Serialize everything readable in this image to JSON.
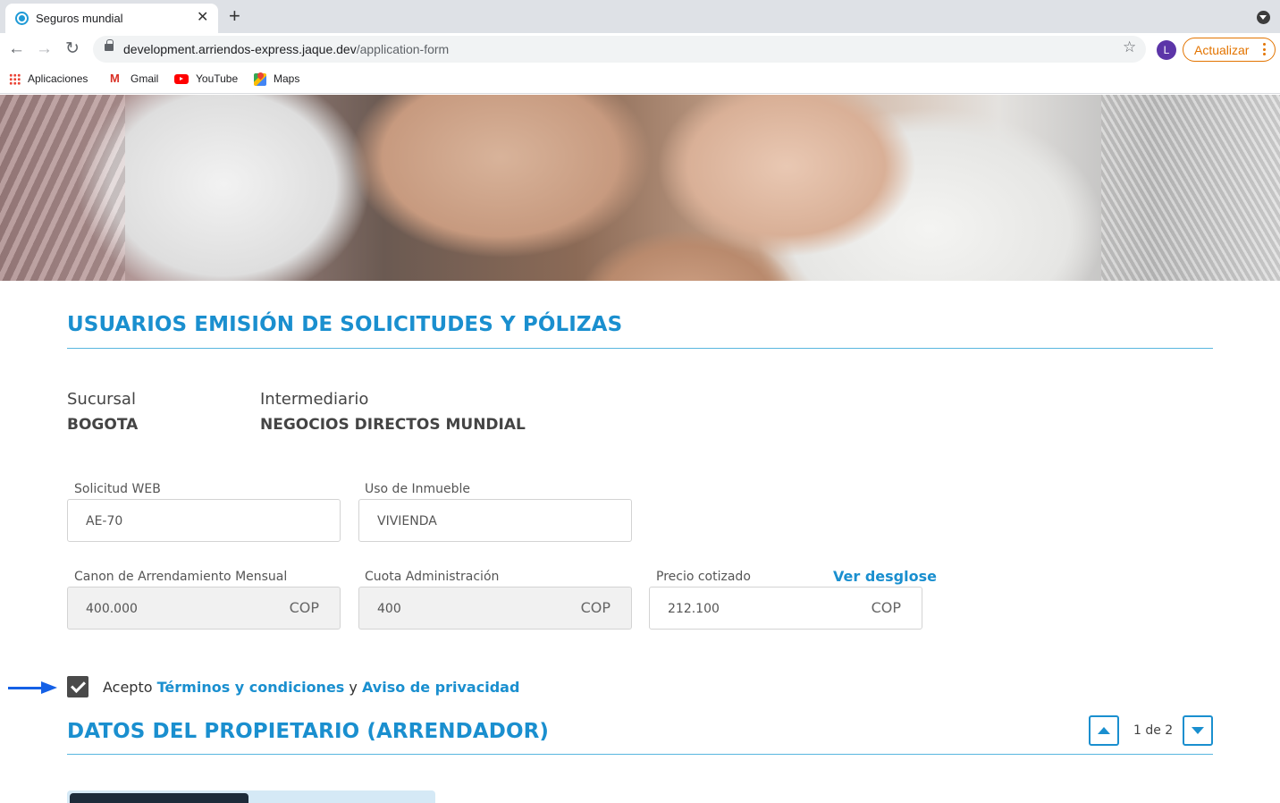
{
  "browser": {
    "tab_title": "Seguros mundial",
    "url_host": "development.arriendos-express.jaque.dev",
    "url_path": "/application-form",
    "profile_initial": "L",
    "update_label": "Actualizar",
    "bookmarks": [
      {
        "label": "Aplicaciones",
        "icon": "apps-icon"
      },
      {
        "label": "Gmail",
        "icon": "gmail-icon"
      },
      {
        "label": "YouTube",
        "icon": "youtube-icon"
      },
      {
        "label": "Maps",
        "icon": "maps-icon"
      }
    ]
  },
  "page": {
    "section1_title": "USUARIOS EMISIÓN DE SOLICITUDES Y PÓLIZAS",
    "branch": {
      "label": "Sucursal",
      "value": "BOGOTA"
    },
    "intermediary": {
      "label": "Intermediario",
      "value": "NEGOCIOS DIRECTOS MUNDIAL"
    },
    "fields": {
      "solicitud_web": {
        "label": "Solicitud WEB",
        "value": "AE-70"
      },
      "uso_inmueble": {
        "label": "Uso de Inmueble",
        "value": "VIVIENDA"
      },
      "canon": {
        "label": "Canon de Arrendamiento Mensual",
        "value": "400.000",
        "unit": "COP"
      },
      "cuota": {
        "label": "Cuota Administración",
        "value": "400",
        "unit": "COP"
      },
      "precio": {
        "label": "Precio cotizado",
        "value": "212.100",
        "unit": "COP",
        "link": "Ver desglose"
      }
    },
    "terms": {
      "prefix": "Acepto",
      "terms_link": "Términos y condiciones",
      "connector": "y",
      "privacy_link": "Aviso de privacidad",
      "checked": true
    },
    "section2_title": "DATOS DEL PROPIETARIO (ARRENDADOR)",
    "pager": "1 de 2"
  },
  "colors": {
    "accent": "#1a8fcf",
    "annotation_arrow": "#1460e6",
    "update_orange": "#e37400"
  }
}
